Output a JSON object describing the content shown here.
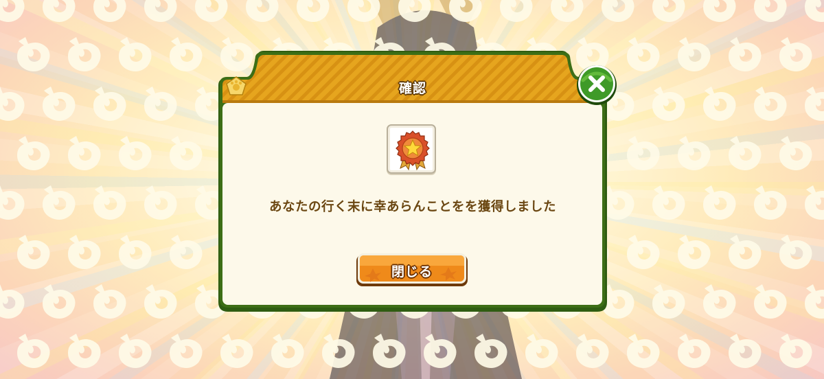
{
  "dialog": {
    "title": "確認",
    "message": "あなたの行く末に幸あらんことをを獲得しました",
    "ok_label": "閉じる",
    "close_icon": "close-x-icon",
    "header_icon": "paw-badge-icon",
    "item_icon": "medal-star-icon"
  },
  "colors": {
    "header_gold": "#e3a21c",
    "header_stripe": "#d38f12",
    "frame_dark": "#2f5d12",
    "panel_bg": "#fdf9ea",
    "button_orange": "#ef8a1a",
    "close_green": "#3f9a28",
    "text_brown": "#6b4712"
  }
}
